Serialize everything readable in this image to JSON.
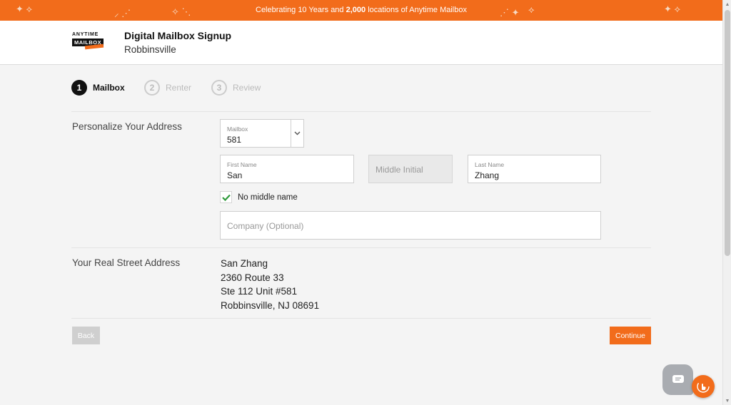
{
  "banner": {
    "text_before": "Celebrating 10 Years and ",
    "text_bold": "2,000",
    "text_after": " locations of Anytime Mailbox"
  },
  "header": {
    "logo_line1": "ANYTIME",
    "logo_line2": "MAILBOX",
    "title": "Digital Mailbox Signup",
    "location": "Robbinsville"
  },
  "stepper": [
    {
      "number": "1",
      "label": "Mailbox",
      "state": "active"
    },
    {
      "number": "2",
      "label": "Renter",
      "state": "inactive"
    },
    {
      "number": "3",
      "label": "Review",
      "state": "inactive"
    }
  ],
  "personalize": {
    "section_label": "Personalize Your Address",
    "mailbox": {
      "label": "Mailbox",
      "value": "581"
    },
    "first_name": {
      "label": "First Name",
      "value": "San"
    },
    "middle_initial": {
      "placeholder": "Middle Initial"
    },
    "last_name": {
      "label": "Last Name",
      "value": "Zhang"
    },
    "no_middle_name": {
      "label": "No middle name",
      "checked": true
    },
    "company": {
      "placeholder": "Company (Optional)"
    }
  },
  "street_address": {
    "section_label": "Your Real Street Address",
    "lines": [
      "San Zhang",
      "2360 Route 33",
      "Ste 112 Unit #581",
      "Robbinsville, NJ 08691"
    ]
  },
  "actions": {
    "back_label": "Back",
    "continue_label": "Continue"
  },
  "colors": {
    "brand_orange": "#f26c1b",
    "check_green": "#2e9a3a"
  },
  "icons": {
    "chat": "chat-bubble-icon",
    "help": "hand-pointer-icon",
    "select": "chevron-down-icon",
    "check": "checkmark-icon"
  }
}
